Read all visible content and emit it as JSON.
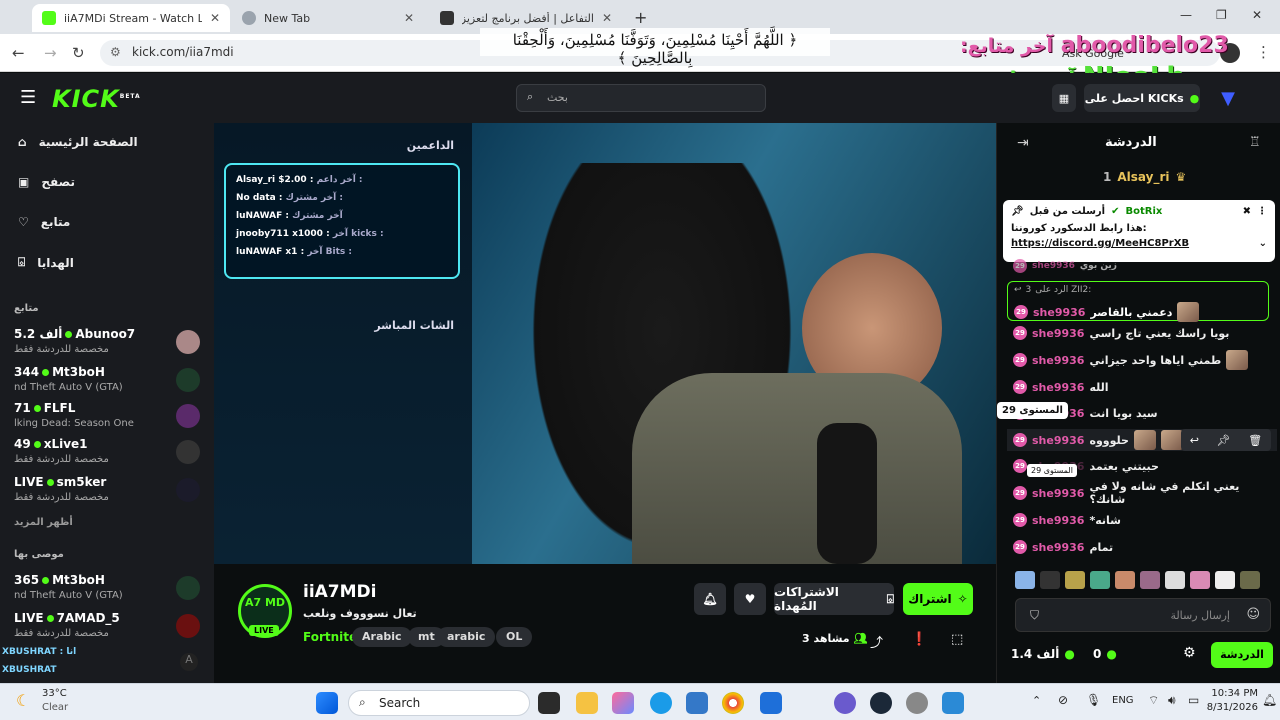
{
  "browser": {
    "tabs": [
      {
        "title": "iiA7MDi Stream - Watch Live o"
      },
      {
        "title": "New Tab"
      },
      {
        "title": "التفاعل | أفضل برنامج لتعزيز البث"
      }
    ],
    "url": "kick.com/iia7mdi"
  },
  "overlay": {
    "dua": "﴿ اللَّهُمَّ أَحْيِنَا مُسْلِمِينَ، وَتَوَفَّنَا مُسْلِمِينَ، وَأَلْحِقْنَا بِالصَّالِحِينَ ﴾",
    "last_follower_1_name": "aboodibelo23",
    "last_follower_1_label": ":آخر متابع",
    "last_follower_2_name": "NJooLh",
    "last_follower_2_label": ":آخر متابع",
    "ask_google": "Ask Google"
  },
  "header": {
    "logo": "KICK",
    "logo_beta": "BETA",
    "search_placeholder": "بحث",
    "get_kicks": "احصل على KICKs"
  },
  "sidebar": {
    "nav": [
      {
        "label": "الصفحة الرئيسية"
      },
      {
        "label": "تصفح"
      },
      {
        "label": "متابع"
      },
      {
        "label": "الهدايا"
      }
    ],
    "following_heading": "متابع",
    "following": [
      {
        "name": "Abunoo7",
        "count": "5.2 ألف",
        "sub": "مخصصة للدردشة فقط"
      },
      {
        "name": "Mt3boH",
        "count": "344",
        "sub": "nd Theft Auto V (GTA)"
      },
      {
        "name": "FLFL",
        "count": "71",
        "sub": "lking Dead: Season One"
      },
      {
        "name": "xLive1",
        "count": "49",
        "sub": "مخصصة للدردشة فقط"
      },
      {
        "name": "sm5ker",
        "count": "LIVE",
        "sub": "مخصصة للدردشة فقط"
      }
    ],
    "show_more": "أظهر المزيد",
    "recommended_heading": "موصى بها",
    "recommended": [
      {
        "name": "Mt3boH",
        "count": "365",
        "sub": "nd Theft Auto V (GTA)"
      },
      {
        "name": "7AMAD_5",
        "count": "LIVE",
        "sub": "مخصصة للدردشة فقط"
      }
    ],
    "overlay_line_1": "XBUSHRAT : انا",
    "overlay_line_2": "XBUSHRAT"
  },
  "video": {
    "supporters_title": "الداعمين",
    "rows": [
      {
        "label": "آخر داعم :",
        "value": "Alsay_ri $2.00"
      },
      {
        "label": "آخر مشترك :",
        "value": "No data"
      },
      {
        "label": "آخر مشترك",
        "value": "luNAWAF"
      },
      {
        "label": "آخر kicks :",
        "value": "jnooby711 x1000"
      },
      {
        "label": "آخر Bits :",
        "value": "luNAWAF x1"
      }
    ],
    "live_chat_title": "الشات المباشر"
  },
  "channel": {
    "name": "iiA7MDi",
    "title": "تعال نسوووف ونلعب",
    "category": "Fortnite",
    "tags": [
      "Arabic",
      "mt",
      "arabic",
      "OL"
    ],
    "live_badge": "LIVE",
    "avatar_text": "A7 MD",
    "subscribe": "اشتراك",
    "gift_subs": "الاشتراكات المُهداة",
    "viewers": "3 مشاهد"
  },
  "chat": {
    "title": "الدردشة",
    "top_gifter_name": "Alsay_ri",
    "top_gifter_count": "1",
    "pinned_by": "أرسلت من قبل",
    "pinned_user": "BotRix",
    "pinned_text": "هذا رابط الدسكورد كوروننا:",
    "pinned_link": "https://discord.gg/MeeHC8PrXB",
    "reply_to": "الرد على ZII2:",
    "reply_count": "3",
    "messages": [
      {
        "user": "she9936",
        "text": "زين بوي"
      },
      {
        "user": "she9936",
        "text": "دعمني بالقاصر"
      },
      {
        "user": "she9936",
        "text": "بويا راسك يعني تاج راسي"
      },
      {
        "user": "she9936",
        "text": "طمني اياها واحد جيزاني"
      },
      {
        "user": "she9936",
        "text": "الله"
      },
      {
        "user": "she9936",
        "text": "سيد بويا انت"
      },
      {
        "user": "she9936",
        "text": "حلوووه"
      },
      {
        "user": "she9936",
        "text": "حبيتني بعتمد"
      },
      {
        "user": "she9936",
        "text": "يعني اتكلم في شانه ولا في شانك؟"
      },
      {
        "user": "she9936",
        "text": "*شانه"
      },
      {
        "user": "she9936",
        "text": "تمام"
      }
    ],
    "level_tooltip": "المستوى 29",
    "level_tooltip_small": "المستوى 29",
    "input_placeholder": "إرسال رسالة",
    "points": "1.4 ألف",
    "kicks": "0",
    "chat_button": "الدردشة"
  },
  "taskbar": {
    "weather_temp": "33°C",
    "weather_desc": "Clear",
    "search": "Search",
    "lang": "ENG",
    "time": "10:34 PM",
    "date": "8/31/2026"
  },
  "colors": {
    "kick_green": "#53fc18",
    "badge_pink": "#e15aa9",
    "panel_cyan": "#4ee7f2"
  }
}
